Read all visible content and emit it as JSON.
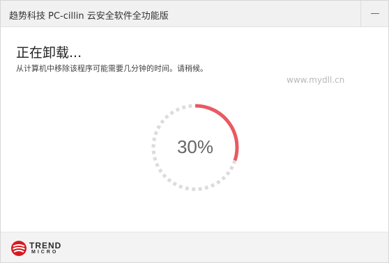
{
  "window": {
    "title": "趋势科技 PC-cillin 云安全软件全功能版"
  },
  "main": {
    "heading": "正在卸载...",
    "subtext": "从计算机中移除该程序可能需要几分钟的时间。请稍候。",
    "watermark": "www.mydll.cn"
  },
  "progress": {
    "value": 0.3,
    "label": "30%"
  },
  "footer": {
    "logo_line1": "TREND",
    "logo_line2": "MICRO"
  },
  "colors": {
    "progress_active": "#e85a62",
    "progress_inactive": "#dcdcdc",
    "logo_red": "#d71920"
  },
  "icons": {
    "minimize": "minimize-icon",
    "logo": "trend-micro-logo-icon"
  }
}
